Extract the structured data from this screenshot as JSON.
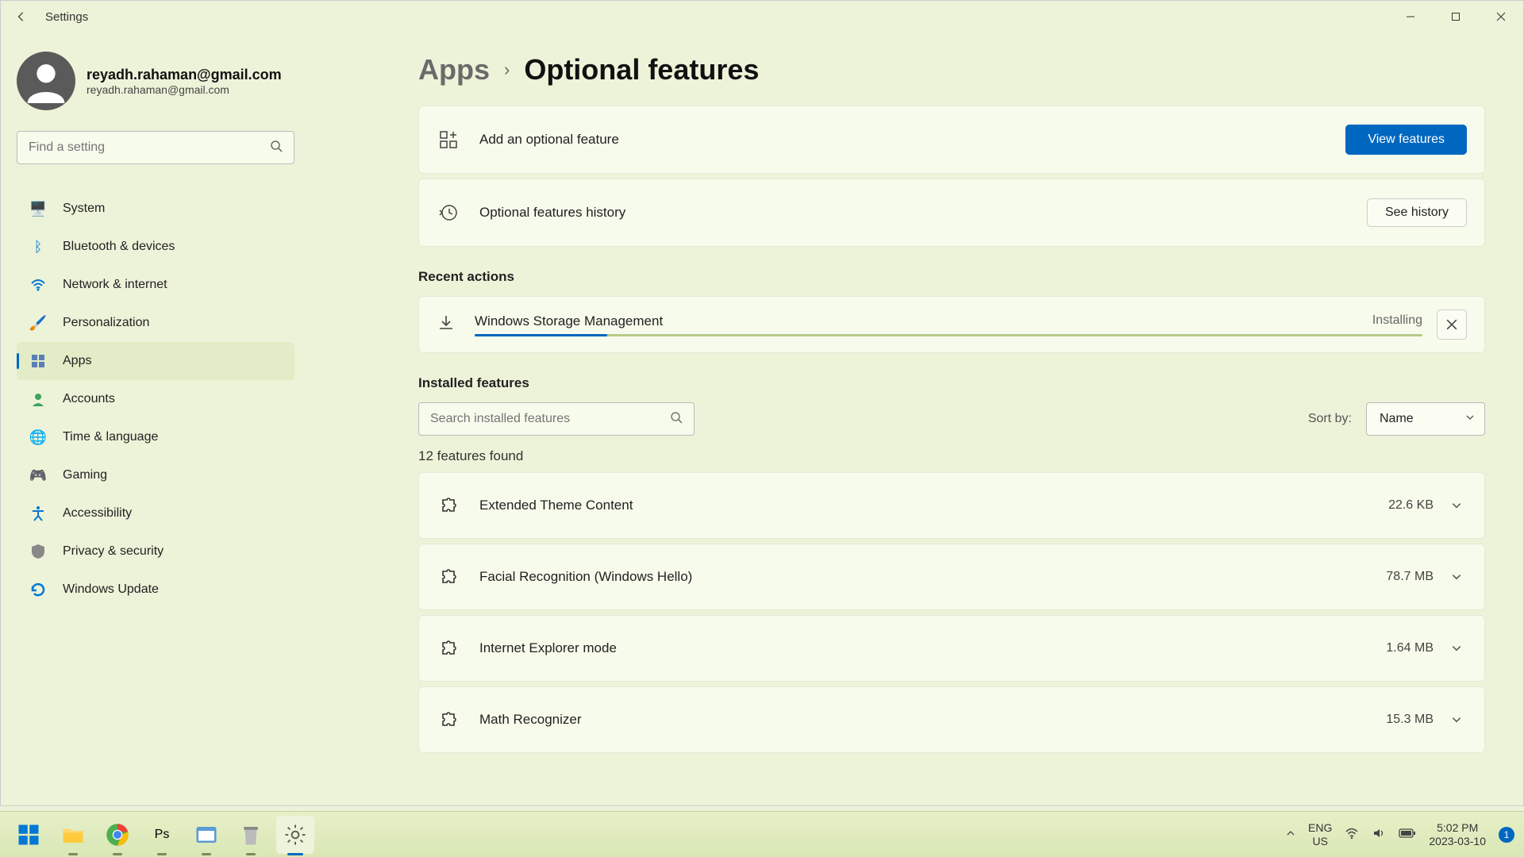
{
  "window": {
    "title": "Settings"
  },
  "user": {
    "name": "reyadh.rahaman@gmail.com",
    "email": "reyadh.rahaman@gmail.com"
  },
  "search": {
    "placeholder": "Find a setting"
  },
  "nav": {
    "items": [
      {
        "label": "System"
      },
      {
        "label": "Bluetooth & devices"
      },
      {
        "label": "Network & internet"
      },
      {
        "label": "Personalization"
      },
      {
        "label": "Apps"
      },
      {
        "label": "Accounts"
      },
      {
        "label": "Time & language"
      },
      {
        "label": "Gaming"
      },
      {
        "label": "Accessibility"
      },
      {
        "label": "Privacy & security"
      },
      {
        "label": "Windows Update"
      }
    ],
    "active_index": 4
  },
  "breadcrumb": {
    "parent": "Apps",
    "current": "Optional features",
    "sep": "›"
  },
  "add_feature": {
    "label": "Add an optional feature",
    "button": "View features"
  },
  "history": {
    "label": "Optional features history",
    "button": "See history"
  },
  "recent": {
    "title": "Recent actions",
    "item": {
      "name": "Windows Storage Management",
      "status": "Installing",
      "progress_pct": 14
    }
  },
  "installed": {
    "title": "Installed features",
    "search_placeholder": "Search installed features",
    "sort_label": "Sort by:",
    "sort_value": "Name",
    "count_text": "12 features found",
    "items": [
      {
        "name": "Extended Theme Content",
        "size": "22.6 KB"
      },
      {
        "name": "Facial Recognition (Windows Hello)",
        "size": "78.7 MB"
      },
      {
        "name": "Internet Explorer mode",
        "size": "1.64 MB"
      },
      {
        "name": "Math Recognizer",
        "size": "15.3 MB"
      }
    ]
  },
  "taskbar": {
    "lang1": "ENG",
    "lang2": "US",
    "time": "5:02 PM",
    "date": "2023-03-10",
    "badge": "1"
  }
}
